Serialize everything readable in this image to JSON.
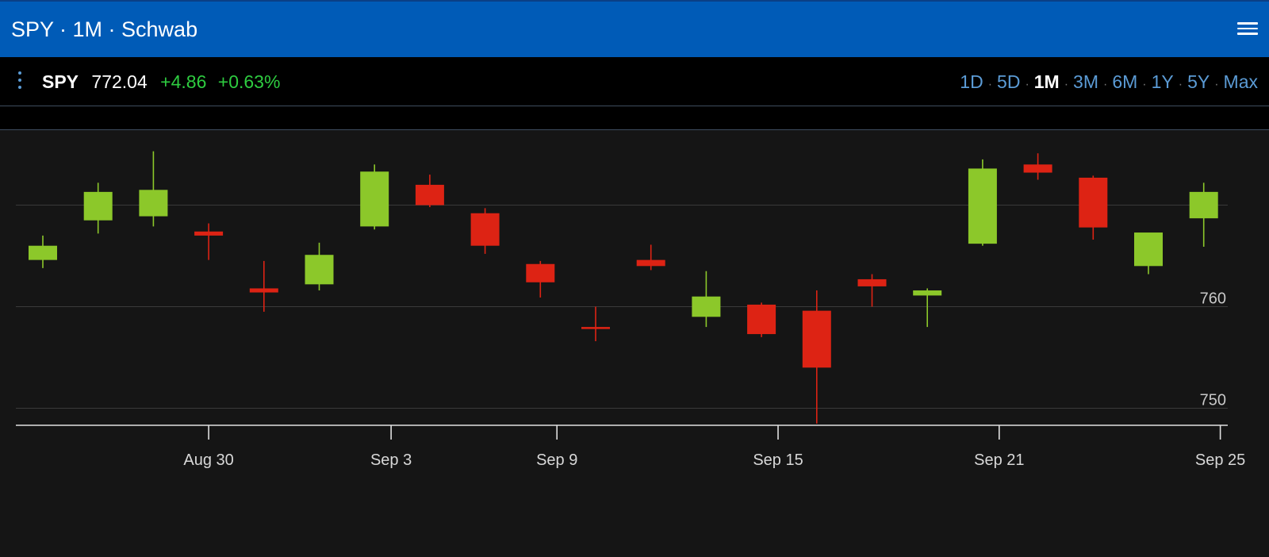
{
  "header": {
    "title": "SPY · 1M · Schwab",
    "menu_icon": "hamburger-menu-icon"
  },
  "quote": {
    "options_icon": "vertical-dots-icon",
    "symbol": "SPY",
    "price": "772.04",
    "change": "+4.86",
    "change_percent": "+0.63%",
    "change_color": "#2ecc40"
  },
  "ranges": [
    {
      "label": "1D",
      "active": false
    },
    {
      "label": "5D",
      "active": false
    },
    {
      "label": "1M",
      "active": true
    },
    {
      "label": "3M",
      "active": false
    },
    {
      "label": "6M",
      "active": false
    },
    {
      "label": "1Y",
      "active": false
    },
    {
      "label": "5Y",
      "active": false
    },
    {
      "label": "Max",
      "active": false
    }
  ],
  "chart_data": {
    "type": "candlestick",
    "up_color": "#8cc82a",
    "down_color": "#dd2314",
    "ylim": [
      748.3,
      777.6
    ],
    "yticks": [
      {
        "value": 750,
        "label": "750"
      },
      {
        "value": 760,
        "label": "760"
      },
      {
        "value": 770,
        "label": ""
      }
    ],
    "xticks": [
      {
        "index": 3,
        "label": "Aug 30"
      },
      {
        "index": 6.3,
        "label": "Sep 3"
      },
      {
        "index": 9.3,
        "label": "Sep 9"
      },
      {
        "index": 13.3,
        "label": "Sep 15"
      },
      {
        "index": 17.3,
        "label": "Sep 21"
      },
      {
        "index": 21.3,
        "label": "Sep 25"
      }
    ],
    "candles": [
      {
        "open": 764.6,
        "high": 767.0,
        "low": 763.8,
        "close": 766.0
      },
      {
        "open": 768.5,
        "high": 772.2,
        "low": 767.2,
        "close": 771.3
      },
      {
        "open": 768.9,
        "high": 775.3,
        "low": 767.9,
        "close": 771.5
      },
      {
        "open": 767.4,
        "high": 768.2,
        "low": 764.6,
        "close": 767.0
      },
      {
        "open": 761.8,
        "high": 764.5,
        "low": 759.5,
        "close": 761.4
      },
      {
        "open": 762.2,
        "high": 766.3,
        "low": 761.6,
        "close": 765.1
      },
      {
        "open": 767.9,
        "high": 774.0,
        "low": 767.6,
        "close": 773.3
      },
      {
        "open": 772.0,
        "high": 773.0,
        "low": 769.8,
        "close": 770.0
      },
      {
        "open": 769.2,
        "high": 769.7,
        "low": 765.2,
        "close": 766.0
      },
      {
        "open": 764.2,
        "high": 764.5,
        "low": 760.9,
        "close": 762.4
      },
      {
        "open": 758.0,
        "high": 760.0,
        "low": 756.6,
        "close": 757.8
      },
      {
        "open": 764.6,
        "high": 766.1,
        "low": 763.6,
        "close": 764.0
      },
      {
        "open": 759.0,
        "high": 763.5,
        "low": 758.0,
        "close": 761.0
      },
      {
        "open": 760.2,
        "high": 760.4,
        "low": 757.0,
        "close": 757.3
      },
      {
        "open": 759.6,
        "high": 761.6,
        "low": 748.5,
        "close": 754.0
      },
      {
        "open": 762.7,
        "high": 763.2,
        "low": 760.0,
        "close": 762.0
      },
      {
        "open": 761.1,
        "high": 761.8,
        "low": 758.0,
        "close": 761.6
      },
      {
        "open": 766.2,
        "high": 774.5,
        "low": 766.0,
        "close": 773.6
      },
      {
        "open": 774.0,
        "high": 775.1,
        "low": 772.5,
        "close": 773.2
      },
      {
        "open": 772.7,
        "high": 772.9,
        "low": 766.6,
        "close": 767.8
      },
      {
        "open": 764.0,
        "high": 766.8,
        "low": 763.2,
        "close": 767.3
      },
      {
        "open": 768.7,
        "high": 772.2,
        "low": 765.9,
        "close": 771.3
      }
    ]
  }
}
